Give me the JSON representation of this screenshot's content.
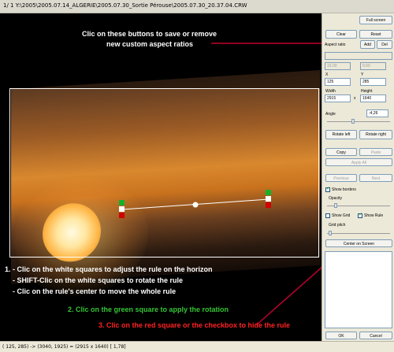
{
  "window": {
    "title": "1/  1  Y:\\2005\\2005.07.14_ALGERIE\\2005.07.30_Sortie Pérouse\\2005.07.30_20.37.04.CRW"
  },
  "annotations": {
    "top": [
      "Clic on these buttons to save or remove",
      "new custom aspect ratios"
    ],
    "instructions": [
      "1. - Clic on the white squares to adjust the rule on the horizon",
      "- SHIFT-Clic on the white squares to rotate the rule",
      "- Clic on the rule's center to move the whole rule"
    ],
    "green_note": "2. Clic on the green square to apply the rotation",
    "red_note": "3. Clic on the red square or the checkbox to hide the rule"
  },
  "panel": {
    "full_screen": "Full screen",
    "clear": "Clear",
    "reset": "Reset",
    "aspect_ratio": "Aspect ratio",
    "add": "Add",
    "del": "Del",
    "aspect_w": "16.00",
    "aspect_h": "9.00",
    "x_label": "X",
    "y_label": "Y",
    "x_value": "125",
    "y_value": "285",
    "width_label": "Width",
    "height_label": "Height",
    "width_value": "2915",
    "height_value": "1640",
    "x_sep": "x",
    "angle_label": "Angle",
    "angle_value": "-4,26",
    "rotate_left": "Rotate left",
    "rotate_right": "Rotate right",
    "copy": "Copy",
    "paste": "Paste",
    "apply_all": "Apply All",
    "previous": "Previous",
    "next": "Next",
    "show_borders": "Show borders",
    "opacity": "Opacity",
    "show_grid": "Show Grid",
    "show_rule": "Show Rule",
    "grid_pitch": "Grid pitch",
    "center_on_screen": "Center on Screen",
    "ok": "OK",
    "cancel": "Cancel"
  },
  "status": {
    "text": "( 125,  285) -> (3040, 1925) = (2915 x 1640)  [ 1,78]"
  },
  "colors": {
    "accent_green": "#35c435",
    "accent_red": "#ff2222",
    "callout_line": "#c0002e"
  }
}
